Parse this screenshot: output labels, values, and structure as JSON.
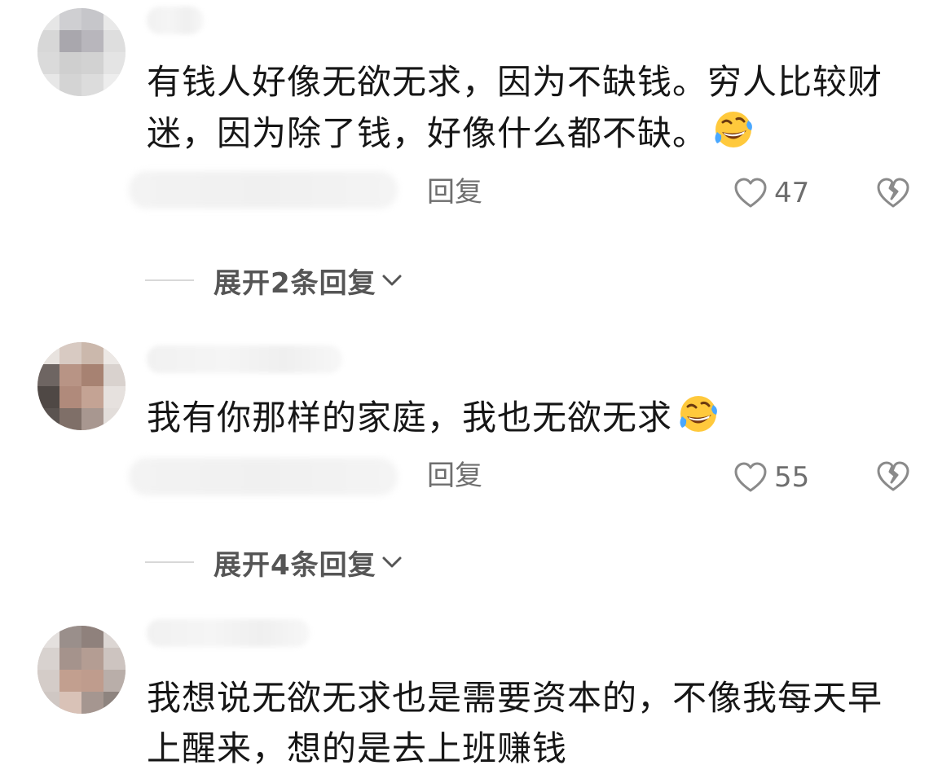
{
  "comments": [
    {
      "text": "有钱人好像无欲无求，因为不缺钱。穷人比较财迷，因为除了钱，好像什么都不缺。",
      "reply_label": "回复",
      "like_count": "47",
      "expand_label": "展开2条回复",
      "emoji": "rofl-face-icon"
    },
    {
      "text": "我有你那样的家庭，我也无欲无求",
      "reply_label": "回复",
      "like_count": "55",
      "expand_label": "展开4条回复",
      "emoji": "rofl-face-icon"
    },
    {
      "text": "我想说无欲无求也是需要资本的，不像我每天早上醒来，想的是去上班赚钱"
    }
  ],
  "icons": {
    "like": "heart-outline-icon",
    "dislike": "broken-heart-icon",
    "expand": "chevron-down-icon"
  },
  "colors": {
    "text": "#161616",
    "meta": "#6e6e6e",
    "expand_text": "#555555",
    "divider": "#d8d8d8",
    "emoji_face": "#ffc93c",
    "emoji_tear": "#4aa8ff"
  }
}
